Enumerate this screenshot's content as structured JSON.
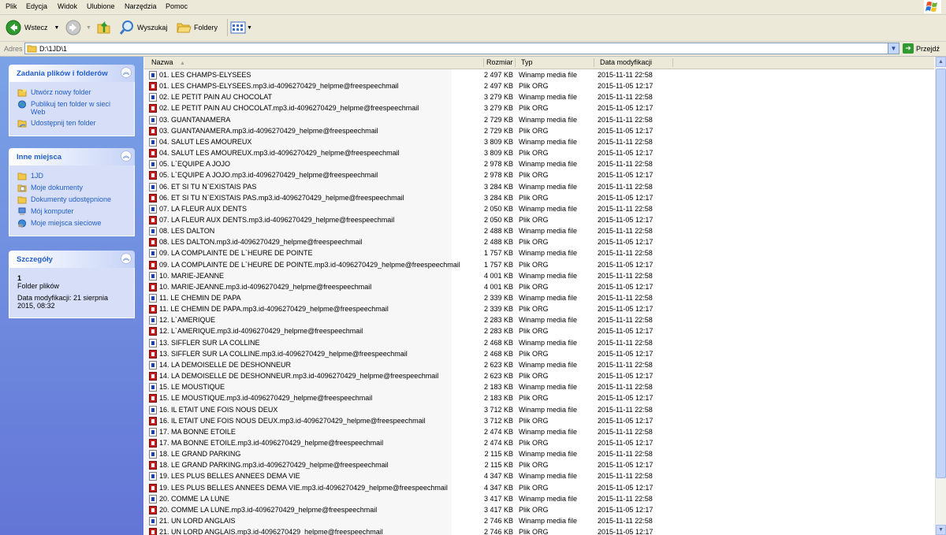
{
  "menu": [
    "Plik",
    "Edycja",
    "Widok",
    "Ulubione",
    "Narzędzia",
    "Pomoc"
  ],
  "toolbar": {
    "back": "Wstecz",
    "search": "Wyszukaj",
    "folders": "Foldery"
  },
  "address": {
    "label": "Adres",
    "path": "D:\\1JD\\1",
    "go": "Przejdź"
  },
  "tasks": {
    "title": "Zadania plików i folderów",
    "items": [
      "Utwórz nowy folder",
      "Publikuj ten folder w sieci Web",
      "Udostępnij ten folder"
    ]
  },
  "places": {
    "title": "Inne miejsca",
    "items": [
      "1JD",
      "Moje dokumenty",
      "Dokumenty udostępnione",
      "Mój komputer",
      "Moje miejsca sieciowe"
    ]
  },
  "details": {
    "title": "Szczegóły",
    "name": "1",
    "kind": "Folder plików",
    "modified": "Data modyfikacji: 21 sierpnia 2015, 08:32"
  },
  "columns": {
    "name": "Nazwa",
    "size": "Rozmiar",
    "type": "Typ",
    "date": "Data modyfikacji"
  },
  "files": [
    {
      "name": "01. LES CHAMPS-ELYSEES",
      "size": "2 497 KB",
      "type": "Winamp media file",
      "date": "2015-11-11 22:58",
      "icon": "wa"
    },
    {
      "name": "01. LES CHAMPS-ELYSEES.mp3.id-4096270429_helpme@freespeechmail",
      "size": "2 497 KB",
      "type": "Plik ORG",
      "date": "2015-11-05 12:17",
      "icon": "org"
    },
    {
      "name": "02. LE PETIT PAIN AU CHOCOLAT",
      "size": "3 279 KB",
      "type": "Winamp media file",
      "date": "2015-11-11 22:58",
      "icon": "wa"
    },
    {
      "name": "02. LE PETIT PAIN AU CHOCOLAT.mp3.id-4096270429_helpme@freespeechmail",
      "size": "3 279 KB",
      "type": "Plik ORG",
      "date": "2015-11-05 12:17",
      "icon": "org"
    },
    {
      "name": "03. GUANTANAMERA",
      "size": "2 729 KB",
      "type": "Winamp media file",
      "date": "2015-11-11 22:58",
      "icon": "wa"
    },
    {
      "name": "03. GUANTANAMERA.mp3.id-4096270429_helpme@freespeechmail",
      "size": "2 729 KB",
      "type": "Plik ORG",
      "date": "2015-11-05 12:17",
      "icon": "org"
    },
    {
      "name": "04. SALUT LES AMOUREUX",
      "size": "3 809 KB",
      "type": "Winamp media file",
      "date": "2015-11-11 22:58",
      "icon": "wa"
    },
    {
      "name": "04. SALUT LES AMOUREUX.mp3.id-4096270429_helpme@freespeechmail",
      "size": "3 809 KB",
      "type": "Plik ORG",
      "date": "2015-11-05 12:17",
      "icon": "org"
    },
    {
      "name": "05. L`EQUIPE A  JOJO",
      "size": "2 978 KB",
      "type": "Winamp media file",
      "date": "2015-11-11 22:58",
      "icon": "wa"
    },
    {
      "name": "05. L`EQUIPE A  JOJO.mp3.id-4096270429_helpme@freespeechmail",
      "size": "2 978 KB",
      "type": "Plik ORG",
      "date": "2015-11-05 12:17",
      "icon": "org"
    },
    {
      "name": "06. ET SI TU N`EXISTAIS PAS",
      "size": "3 284 KB",
      "type": "Winamp media file",
      "date": "2015-11-11 22:58",
      "icon": "wa"
    },
    {
      "name": "06. ET SI TU N`EXISTAIS PAS.mp3.id-4096270429_helpme@freespeechmail",
      "size": "3 284 KB",
      "type": "Plik ORG",
      "date": "2015-11-05 12:17",
      "icon": "org"
    },
    {
      "name": "07. LA FLEUR AUX DENTS",
      "size": "2 050 KB",
      "type": "Winamp media file",
      "date": "2015-11-11 22:58",
      "icon": "wa"
    },
    {
      "name": "07. LA FLEUR AUX DENTS.mp3.id-4096270429_helpme@freespeechmail",
      "size": "2 050 KB",
      "type": "Plik ORG",
      "date": "2015-11-05 12:17",
      "icon": "org"
    },
    {
      "name": "08. LES DALTON",
      "size": "2 488 KB",
      "type": "Winamp media file",
      "date": "2015-11-11 22:58",
      "icon": "wa"
    },
    {
      "name": "08. LES DALTON.mp3.id-4096270429_helpme@freespeechmail",
      "size": "2 488 KB",
      "type": "Plik ORG",
      "date": "2015-11-05 12:17",
      "icon": "org"
    },
    {
      "name": "09. LA COMPLAINTE DE L`HEURE DE POINTE",
      "size": "1 757 KB",
      "type": "Winamp media file",
      "date": "2015-11-11 22:58",
      "icon": "wa"
    },
    {
      "name": "09. LA COMPLAINTE DE L`HEURE DE POINTE.mp3.id-4096270429_helpme@freespeechmail",
      "size": "1 757 KB",
      "type": "Plik ORG",
      "date": "2015-11-05 12:17",
      "icon": "org"
    },
    {
      "name": "10. MARIE-JEANNE",
      "size": "4 001 KB",
      "type": "Winamp media file",
      "date": "2015-11-11 22:58",
      "icon": "wa"
    },
    {
      "name": "10. MARIE-JEANNE.mp3.id-4096270429_helpme@freespeechmail",
      "size": "4 001 KB",
      "type": "Plik ORG",
      "date": "2015-11-05 12:17",
      "icon": "org"
    },
    {
      "name": "11. LE CHEMIN DE PAPA",
      "size": "2 339 KB",
      "type": "Winamp media file",
      "date": "2015-11-11 22:58",
      "icon": "wa"
    },
    {
      "name": "11. LE CHEMIN DE PAPA.mp3.id-4096270429_helpme@freespeechmail",
      "size": "2 339 KB",
      "type": "Plik ORG",
      "date": "2015-11-05 12:17",
      "icon": "org"
    },
    {
      "name": "12. L`AMERIQUE",
      "size": "2 283 KB",
      "type": "Winamp media file",
      "date": "2015-11-11 22:58",
      "icon": "wa"
    },
    {
      "name": "12. L`AMERIQUE.mp3.id-4096270429_helpme@freespeechmail",
      "size": "2 283 KB",
      "type": "Plik ORG",
      "date": "2015-11-05 12:17",
      "icon": "org"
    },
    {
      "name": "13. SIFFLER SUR LA COLLINE",
      "size": "2 468 KB",
      "type": "Winamp media file",
      "date": "2015-11-11 22:58",
      "icon": "wa"
    },
    {
      "name": "13. SIFFLER SUR LA COLLINE.mp3.id-4096270429_helpme@freespeechmail",
      "size": "2 468 KB",
      "type": "Plik ORG",
      "date": "2015-11-05 12:17",
      "icon": "org"
    },
    {
      "name": "14. LA DEMOISELLE DE DESHONNEUR",
      "size": "2 623 KB",
      "type": "Winamp media file",
      "date": "2015-11-11 22:58",
      "icon": "wa"
    },
    {
      "name": "14. LA DEMOISELLE DE DESHONNEUR.mp3.id-4096270429_helpme@freespeechmail",
      "size": "2 623 KB",
      "type": "Plik ORG",
      "date": "2015-11-05 12:17",
      "icon": "org"
    },
    {
      "name": "15. LE MOUSTIQUE",
      "size": "2 183 KB",
      "type": "Winamp media file",
      "date": "2015-11-11 22:58",
      "icon": "wa"
    },
    {
      "name": "15. LE MOUSTIQUE.mp3.id-4096270429_helpme@freespeechmail",
      "size": "2 183 KB",
      "type": "Plik ORG",
      "date": "2015-11-05 12:17",
      "icon": "org"
    },
    {
      "name": "16. IL ETAIT UNE FOIS NOUS DEUX",
      "size": "3 712 KB",
      "type": "Winamp media file",
      "date": "2015-11-11 22:58",
      "icon": "wa"
    },
    {
      "name": "16. IL ETAIT UNE FOIS NOUS DEUX.mp3.id-4096270429_helpme@freespeechmail",
      "size": "3 712 KB",
      "type": "Plik ORG",
      "date": "2015-11-05 12:17",
      "icon": "org"
    },
    {
      "name": "17. MA BONNE ETOILE",
      "size": "2 474 KB",
      "type": "Winamp media file",
      "date": "2015-11-11 22:58",
      "icon": "wa"
    },
    {
      "name": "17. MA BONNE ETOILE.mp3.id-4096270429_helpme@freespeechmail",
      "size": "2 474 KB",
      "type": "Plik ORG",
      "date": "2015-11-05 12:17",
      "icon": "org"
    },
    {
      "name": "18. LE GRAND PARKING",
      "size": "2 115 KB",
      "type": "Winamp media file",
      "date": "2015-11-11 22:58",
      "icon": "wa"
    },
    {
      "name": "18. LE GRAND PARKING.mp3.id-4096270429_helpme@freespeechmail",
      "size": "2 115 KB",
      "type": "Plik ORG",
      "date": "2015-11-05 12:17",
      "icon": "org"
    },
    {
      "name": "19. LES PLUS BELLES ANNEES DEMA VIE",
      "size": "4 347 KB",
      "type": "Winamp media file",
      "date": "2015-11-11 22:58",
      "icon": "wa"
    },
    {
      "name": "19. LES PLUS BELLES ANNEES DEMA VIE.mp3.id-4096270429_helpme@freespeechmail",
      "size": "4 347 KB",
      "type": "Plik ORG",
      "date": "2015-11-05 12:17",
      "icon": "org"
    },
    {
      "name": "20. COMME LA LUNE",
      "size": "3 417 KB",
      "type": "Winamp media file",
      "date": "2015-11-11 22:58",
      "icon": "wa"
    },
    {
      "name": "20. COMME LA LUNE.mp3.id-4096270429_helpme@freespeechmail",
      "size": "3 417 KB",
      "type": "Plik ORG",
      "date": "2015-11-05 12:17",
      "icon": "org"
    },
    {
      "name": "21. UN LORD ANGLAIS",
      "size": "2 746 KB",
      "type": "Winamp media file",
      "date": "2015-11-11 22:58",
      "icon": "wa"
    },
    {
      "name": "21. UN LORD ANGLAIS.mp3.id-4096270429_helpme@freespeechmail",
      "size": "2 746 KB",
      "type": "Plik ORG",
      "date": "2015-11-05 12:17",
      "icon": "org"
    }
  ]
}
